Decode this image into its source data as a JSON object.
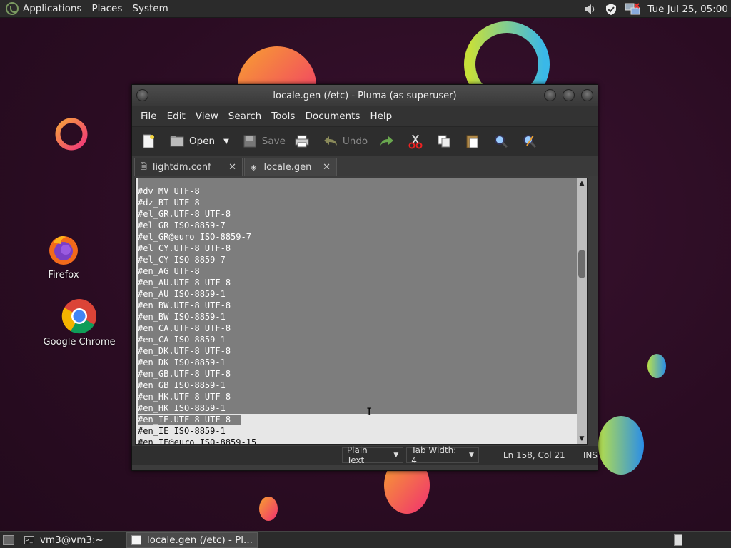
{
  "top_panel": {
    "menus": [
      "Applications",
      "Places",
      "System"
    ],
    "clock": "Tue Jul 25, 05:00",
    "tray_icons": [
      "volume-icon",
      "shield-icon",
      "network-icon"
    ]
  },
  "desktop": {
    "icons": [
      {
        "label": "Firefox",
        "icon": "firefox-icon"
      },
      {
        "label": "Google Chrome",
        "icon": "chrome-icon"
      }
    ]
  },
  "window": {
    "title": "locale.gen (/etc) - Pluma (as superuser)",
    "menu": [
      "File",
      "Edit",
      "View",
      "Search",
      "Tools",
      "Documents",
      "Help"
    ],
    "toolbar": {
      "open_label": "Open",
      "save_label": "Save",
      "undo_label": "Undo"
    },
    "tabs": [
      {
        "label": "lightdm.conf",
        "active": false
      },
      {
        "label": "locale.gen",
        "active": true
      }
    ],
    "editor": {
      "lines": [
        "#dv_MV UTF-8",
        "#dz_BT UTF-8",
        "#el_GR.UTF-8 UTF-8",
        "#el_GR ISO-8859-7",
        "#el_GR@euro ISO-8859-7",
        "#el_CY.UTF-8 UTF-8",
        "#el_CY ISO-8859-7",
        "#en_AG UTF-8",
        "#en_AU.UTF-8 UTF-8",
        "#en_AU ISO-8859-1",
        "#en_BW.UTF-8 UTF-8",
        "#en_BW ISO-8859-1",
        "#en_CA.UTF-8 UTF-8",
        "#en_CA ISO-8859-1",
        "#en_DK.UTF-8 UTF-8",
        "#en_DK ISO-8859-1",
        "#en_GB.UTF-8 UTF-8",
        "#en_GB ISO-8859-1",
        "#en_HK.UTF-8 UTF-8",
        "#en_HK ISO-8859-1",
        "#en_IE.UTF-8 UTF-8",
        "#en_IE ISO-8859-1",
        "#en_IE@euro ISO-8859-15"
      ],
      "selected_full_lines": 20,
      "partial_selected_line": 20
    },
    "status": {
      "language": "Plain Text",
      "tab_width": "Tab Width:  4",
      "position": "Ln 158, Col 21",
      "mode": "INS"
    }
  },
  "bottom_panel": {
    "tasks": [
      {
        "label": "vm3@vm3:~",
        "active": false
      },
      {
        "label": "locale.gen (/etc) - Pl...",
        "active": true
      }
    ]
  },
  "colors": {
    "desktop_bg": "#2a0c22",
    "selection": "#7d7d7d",
    "editor_bg": "#e7e7e7"
  }
}
